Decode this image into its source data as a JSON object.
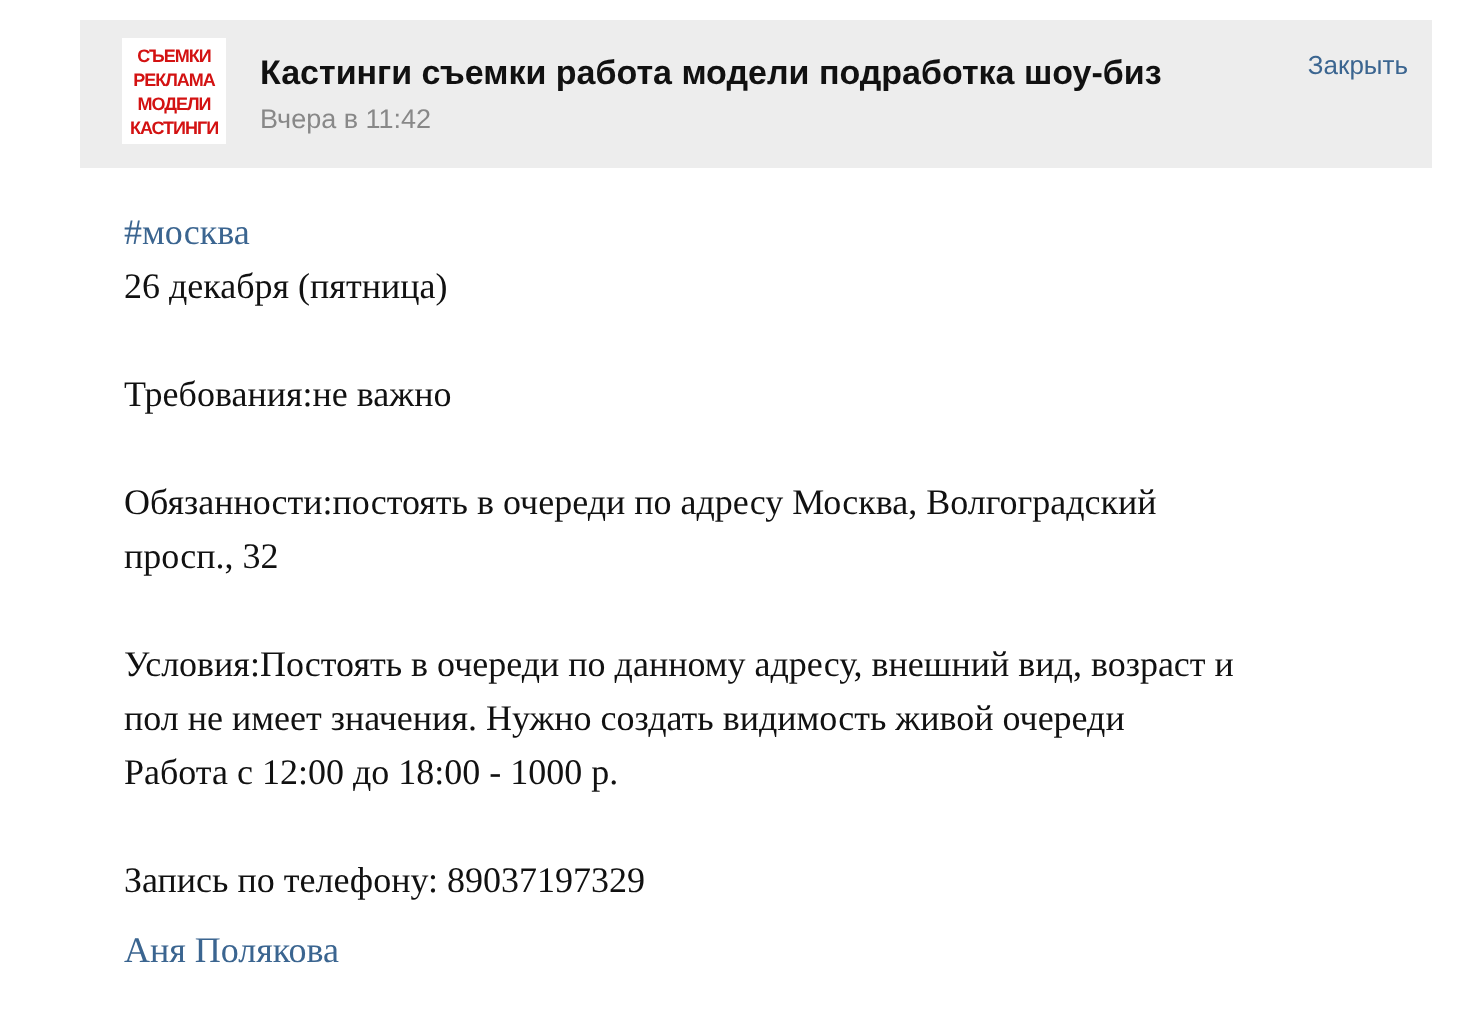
{
  "post_header": {
    "logo_lines": [
      "СЪЕМКИ",
      "РЕКЛАМА",
      "МОДЕЛИ",
      "КАСТИНГИ"
    ],
    "title": "Кастинги съемки работа модели подработка шоу-биз",
    "time": "Вчера в 11:42",
    "close": "Закрыть"
  },
  "body": [
    {
      "kind": "link",
      "lines": [
        "#москва"
      ]
    },
    {
      "kind": "text",
      "lines": [
        "26 декабря (пятница)"
      ]
    },
    {
      "kind": "blank"
    },
    {
      "kind": "text",
      "lines": [
        "Требования:не важно"
      ]
    },
    {
      "kind": "blank"
    },
    {
      "kind": "text",
      "lines": [
        "Обязанности:постоять в очереди по адресу Москва, Волгоградский",
        "просп., 32"
      ]
    },
    {
      "kind": "blank"
    },
    {
      "kind": "text",
      "lines": [
        "Условия:Постоять в очереди по данному адресу, внешний вид, возраст и",
        "пол не имеет значения. Нужно создать видимость живой очереди",
        "Работа с 12:00 до 18:00 - 1000 р."
      ]
    },
    {
      "kind": "blank"
    },
    {
      "kind": "text",
      "lines": [
        "Запись по телефону: 89037197329"
      ]
    },
    {
      "kind": "author",
      "lines": [
        "Аня Полякова"
      ]
    }
  ]
}
